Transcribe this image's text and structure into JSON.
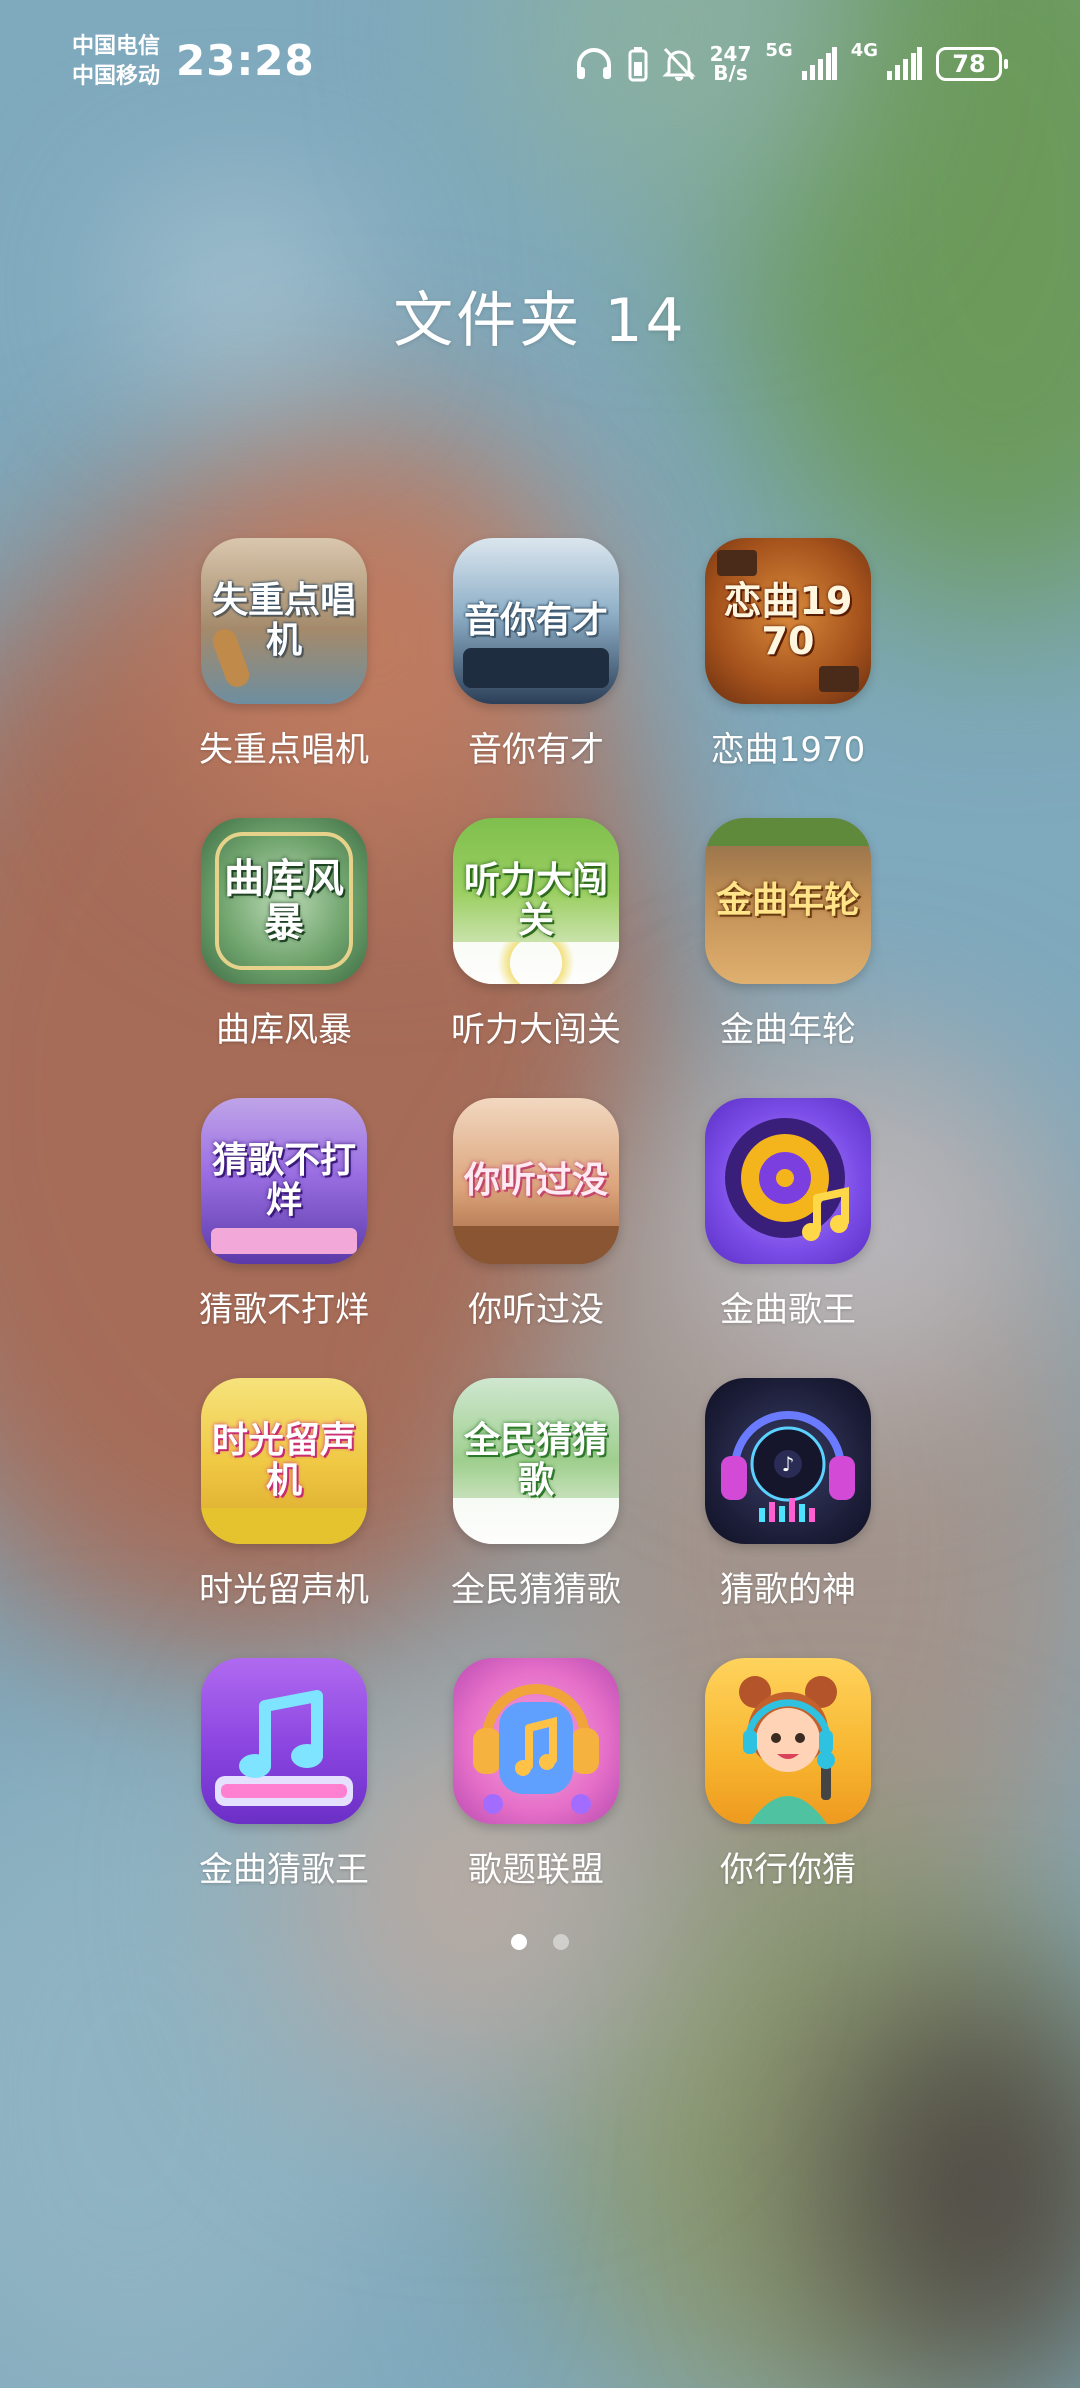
{
  "status_bar": {
    "carrier_1": "中国电信",
    "carrier_2": "中国移动",
    "time": "23:28",
    "icons": [
      "headphones-icon",
      "battery-saver-icon",
      "mute-bell-icon"
    ],
    "net_speed_value": "247",
    "net_speed_unit": "B/s",
    "signal_1_label": "5G",
    "signal_2_label": "4G",
    "battery_level": "78"
  },
  "folder": {
    "title": "文件夹 14"
  },
  "apps": [
    {
      "label": "失重点唱机",
      "icon_text": "失重点唱机"
    },
    {
      "label": "音你有才",
      "icon_text": "音你有才"
    },
    {
      "label": "恋曲1970",
      "icon_text": "恋曲1970"
    },
    {
      "label": "曲库风暴",
      "icon_text": "曲库风暴"
    },
    {
      "label": "听力大闯关",
      "icon_text": "听力大闯关"
    },
    {
      "label": "金曲年轮",
      "icon_text": "金曲年轮"
    },
    {
      "label": "猜歌不打烊",
      "icon_text": "猜歌不打烊"
    },
    {
      "label": "你听过没",
      "icon_text": "你听过没"
    },
    {
      "label": "金曲歌王",
      "icon_text": ""
    },
    {
      "label": "时光留声机",
      "icon_text": "时光留声机"
    },
    {
      "label": "全民猜猜歌",
      "icon_text": "全民猜猜歌"
    },
    {
      "label": "猜歌的神",
      "icon_text": ""
    },
    {
      "label": "金曲猜歌王",
      "icon_text": ""
    },
    {
      "label": "歌题联盟",
      "icon_text": ""
    },
    {
      "label": "你行你猜",
      "icon_text": ""
    }
  ],
  "pager": {
    "active_color": "#ffffff",
    "inactive_color": "rgba(255,255,255,0.45)"
  }
}
